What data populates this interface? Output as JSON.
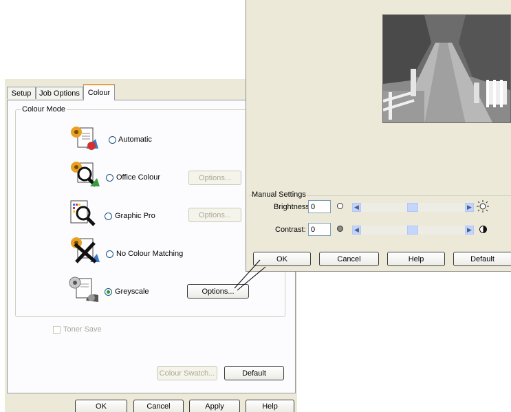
{
  "main_dialog": {
    "tabs": [
      {
        "label": "Setup"
      },
      {
        "label": "Job Options"
      },
      {
        "label": "Colour"
      }
    ],
    "colour_mode": {
      "legend": "Colour Mode",
      "options": [
        {
          "label": "Automatic",
          "selected": false
        },
        {
          "label": "Office Colour",
          "selected": false,
          "options_button": "Options...",
          "options_enabled": false
        },
        {
          "label": "Graphic Pro",
          "selected": false,
          "options_button": "Options...",
          "options_enabled": false
        },
        {
          "label": "No Colour Matching",
          "selected": false
        },
        {
          "label": "Greyscale",
          "selected": true,
          "options_button": "Options...",
          "options_enabled": true
        }
      ]
    },
    "toner_save": {
      "label": "Toner Save",
      "checked": false,
      "enabled": false
    },
    "colour_swatch_button": "Colour Swatch...",
    "default_button": "Default",
    "footer": {
      "ok": "OK",
      "cancel": "Cancel",
      "apply": "Apply",
      "help": "Help"
    }
  },
  "greyscale_dialog": {
    "manual_settings": {
      "legend": "Manual Settings",
      "brightness": {
        "label": "Brightness:",
        "value": "0",
        "slider_level": 0.5
      },
      "contrast": {
        "label": "Contrast:",
        "value": "0",
        "slider_level": 0.5
      }
    },
    "footer": {
      "ok": "OK",
      "cancel": "Cancel",
      "help": "Help",
      "default": "Default"
    }
  },
  "colors": {
    "dialog_bg": "#ece9d8",
    "window_bg": "#f1efe2",
    "accent_tab": "#e8a33d",
    "radio_selected": "#2b9a28",
    "field_border": "#7f9db9"
  }
}
